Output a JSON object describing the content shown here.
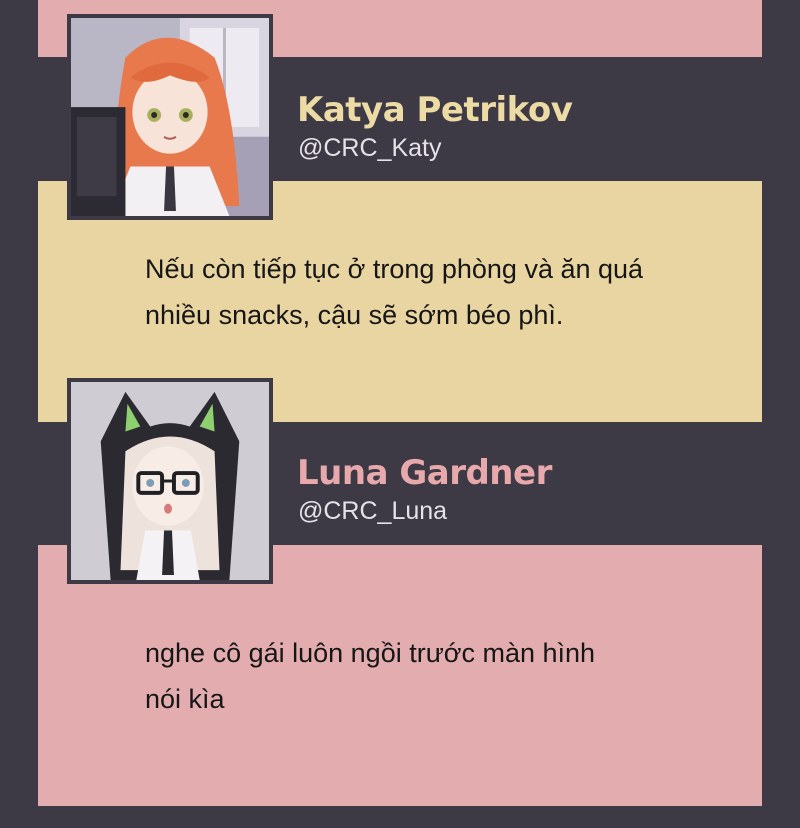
{
  "colors": {
    "background": "#3d3a45",
    "pink_panel": "#e3adb0",
    "cream_panel": "#e9d5a1",
    "katya_name": "#ecdba4",
    "luna_name": "#e8a9ac",
    "handle_text": "#e7e2e8",
    "message_text": "#161616"
  },
  "messages": [
    {
      "name": "Katya Petrikov",
      "handle": "@CRC_Katy",
      "avatar_icon": "katya-avatar-portrait",
      "panel_color": "#e9d5a1",
      "name_color": "#ecdba4",
      "lines": [
        "Nếu còn tiếp tục ở trong phòng và ăn quá",
        "nhiều snacks, cậu sẽ sớm béo phì."
      ]
    },
    {
      "name": "Luna Gardner",
      "handle": "@CRC_Luna",
      "avatar_icon": "luna-avatar-portrait",
      "panel_color": "#e3adb0",
      "name_color": "#e8a9ac",
      "lines": [
        "nghe cô gái luôn ngồi trước màn hình",
        "nói kìa"
      ]
    }
  ]
}
